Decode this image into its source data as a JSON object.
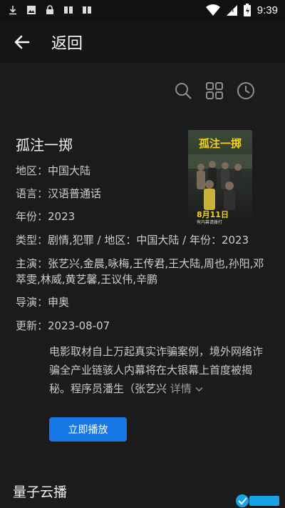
{
  "statusbar": {
    "time": "9:39",
    "left_icons": [
      "download-icon",
      "image-icon",
      "lock-icon",
      "book-icon",
      "book-icon"
    ],
    "right_icons": [
      "wifi-icon",
      "signal-icon",
      "battery-icon"
    ]
  },
  "header": {
    "back_label": "返回"
  },
  "toolbar": {
    "icons": [
      "search-icon",
      "grid-icon",
      "history-icon"
    ]
  },
  "movie": {
    "title": "孤注一掷",
    "region": {
      "label": "地区：",
      "value": "中国大陆"
    },
    "language": {
      "label": "语言：",
      "value": "汉语普通话"
    },
    "year": {
      "label": "年份：",
      "value": "2023"
    },
    "genre": {
      "label": "类型：",
      "value": "剧情,犯罪 / 地区：中国大陆 / 年份：2023"
    },
    "cast": {
      "label": "主演：",
      "value": "张艺兴,金晨,咏梅,王传君,王大陆,周也,孙阳,邓萃雯,林威,黄艺馨,王议伟,辛鹏"
    },
    "director": {
      "label": "导演：",
      "value": "申奥"
    },
    "updated": {
      "label": "更新：",
      "value": "2023-08-07"
    },
    "description": "电影取材自上万起真实诈骗案例，境外网络诈骗全产业链骇人内幕将在大银幕上首度被揭秘。程序员潘生（张艺兴",
    "more_label": "详情"
  },
  "poster": {
    "title_text": "孤注一掷",
    "date_text": "8月11日",
    "sub_text": "有内幕请拨打"
  },
  "actions": {
    "play_label": "立即播放"
  },
  "section": {
    "title": "量子云播"
  },
  "colors": {
    "accent": "#1677e6",
    "background": "#1b1b1d"
  }
}
